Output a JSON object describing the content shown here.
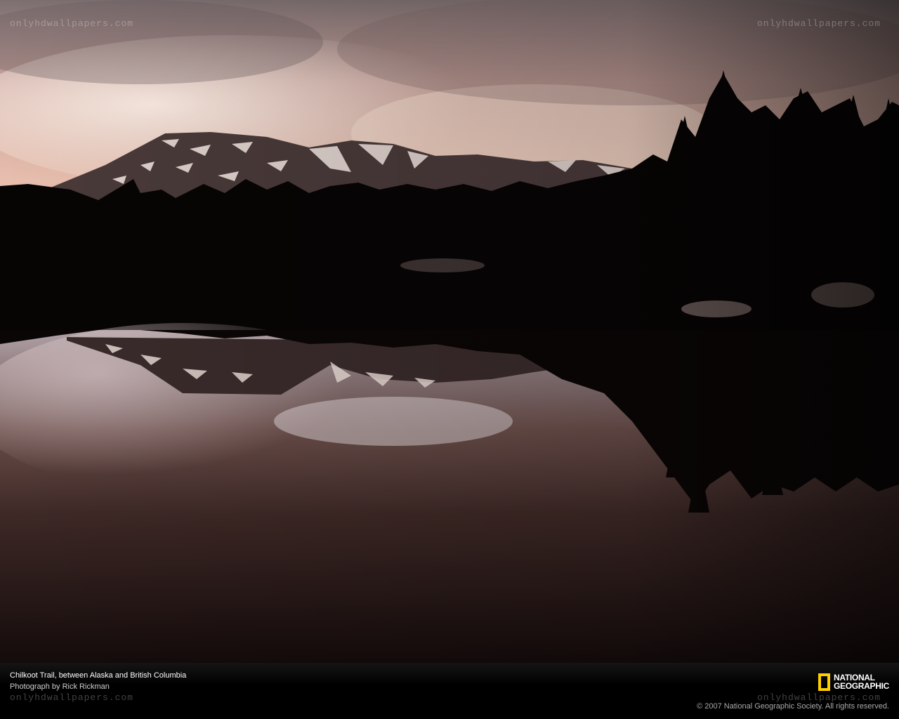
{
  "watermark": {
    "text": "onlyhdwallpapers.com"
  },
  "caption": {
    "title": "Chilkoot Trail, between Alaska and British Columbia",
    "credit": "Photograph by Rick Rickman",
    "copyright": "© 2007 National Geographic Society. All rights reserved."
  },
  "logo": {
    "line1": "NATIONAL",
    "line2": "GEOGRAPHIC",
    "border_color": "#ffce00"
  },
  "colors": {
    "sky_top": "#8a7a78",
    "sky_glow": "#e3b6a4",
    "water": "#3a2624",
    "forest": "#050303"
  }
}
